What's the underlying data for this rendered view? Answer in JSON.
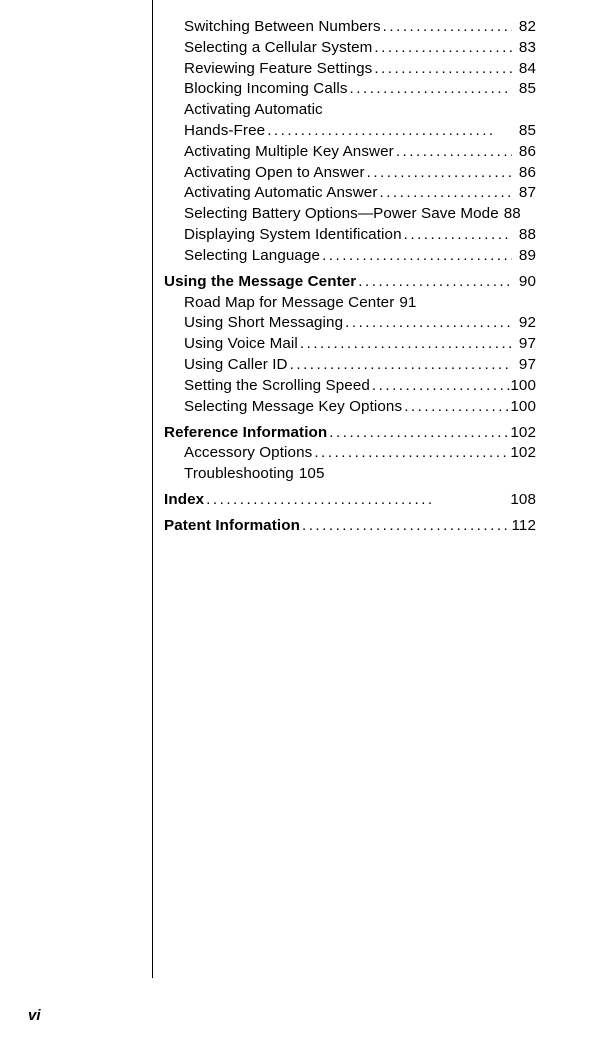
{
  "toc": {
    "continued_sub": [
      {
        "label": "Switching Between Numbers",
        "page": "82"
      },
      {
        "label": "Selecting a Cellular System",
        "page": "83"
      },
      {
        "label": "Reviewing Feature Settings",
        "page": "84"
      },
      {
        "label": "Blocking Incoming Calls",
        "page": "85"
      },
      {
        "label_line1": "Activating Automatic",
        "label_line2": "Hands-Free",
        "page": "85",
        "multiline": true
      },
      {
        "label": "Activating Multiple Key Answer",
        "page": "86"
      },
      {
        "label": "Activating Open to Answer",
        "page": "86"
      },
      {
        "label": "Activating Automatic Answer",
        "page": "87"
      },
      {
        "label": "Selecting Battery Options—Power Save Mode",
        "page": "88",
        "nodots": true
      },
      {
        "label": "Displaying System Identification",
        "page": "88"
      },
      {
        "label": "Selecting Language",
        "page": "89"
      }
    ],
    "sections": [
      {
        "heading": {
          "label": "Using the Message Center",
          "page": "90"
        },
        "items": [
          {
            "label": "Road Map for Message Center",
            "page": "91",
            "nodots": true,
            "inline_page": true
          },
          {
            "label": "Using Short Messaging",
            "page": "92"
          },
          {
            "label": "Using Voice Mail",
            "page": "97"
          },
          {
            "label": "Using Caller ID",
            "page": "97"
          },
          {
            "label": "Setting the Scrolling Speed",
            "page": "100"
          },
          {
            "label": "Selecting Message Key Options",
            "page": "100"
          }
        ]
      },
      {
        "heading": {
          "label": "Reference Information",
          "page": "102"
        },
        "items": [
          {
            "label": "Accessory Options",
            "page": "102"
          },
          {
            "label": "Troubleshooting",
            "page": "105",
            "nodots": true,
            "inline_page": true
          }
        ]
      },
      {
        "heading": {
          "label": "Index",
          "page": "108"
        },
        "items": []
      },
      {
        "heading": {
          "label": "Patent Information",
          "page": "112"
        },
        "items": []
      }
    ]
  },
  "footer": "vi"
}
